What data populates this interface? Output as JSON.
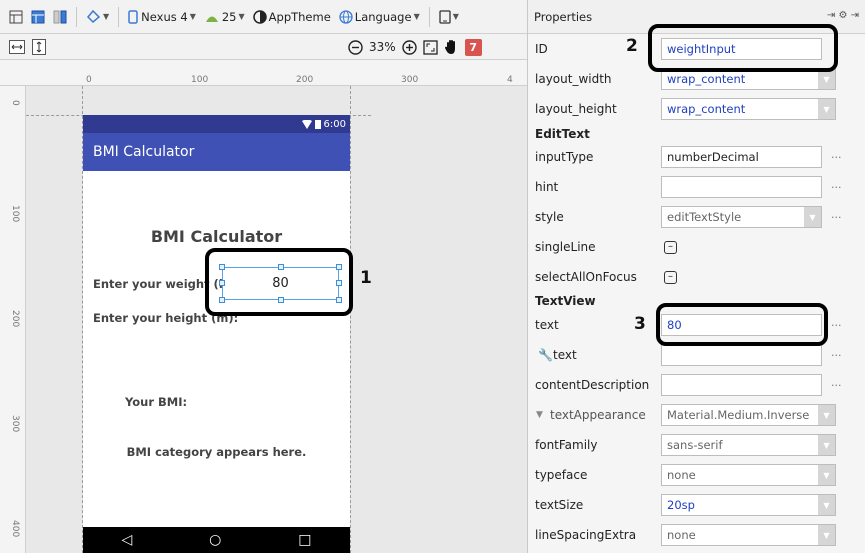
{
  "toolbar": {
    "device": "Nexus 4",
    "api": "25",
    "theme": "AppTheme",
    "language": "Language"
  },
  "toolbar2": {
    "zoom": "33%",
    "issues_count": "7"
  },
  "ruler": {
    "h_ticks": [
      "0",
      "100",
      "200",
      "300",
      "4"
    ],
    "v_ticks": [
      "0",
      "100",
      "200",
      "300",
      "400"
    ]
  },
  "phone": {
    "status_time": "6:00",
    "app_title": "BMI Calculator",
    "heading": "BMI Calculator",
    "weight_label": "Enter your weight (kg):",
    "weight_value": "80",
    "height_label": "Enter your height (m):",
    "bmi_label": "Your BMI:",
    "category_text": "BMI category appears here.",
    "nav": {
      "back": "◁",
      "home": "○",
      "recents": "□"
    }
  },
  "callouts": {
    "one": "1",
    "two": "2",
    "three": "3"
  },
  "properties": {
    "header": "Properties",
    "rows": {
      "id": {
        "name": "ID",
        "value": "weightInput"
      },
      "layout_width": {
        "name": "layout_width",
        "value": "wrap_content"
      },
      "layout_height": {
        "name": "layout_height",
        "value": "wrap_content"
      },
      "edittext_section": "EditText",
      "input_type": {
        "name": "inputType",
        "value": "numberDecimal"
      },
      "hint": {
        "name": "hint",
        "value": ""
      },
      "style": {
        "name": "style",
        "value": "editTextStyle"
      },
      "single_line": {
        "name": "singleLine"
      },
      "select_all": {
        "name": "selectAllOnFocus"
      },
      "textview_section": "TextView",
      "text": {
        "name": "text",
        "value": "80"
      },
      "tools_text": {
        "name": "text",
        "value": ""
      },
      "content_desc": {
        "name": "contentDescription",
        "value": ""
      },
      "text_appearance": {
        "name": "textAppearance",
        "value": "Material.Medium.Inverse"
      },
      "font_family": {
        "name": "fontFamily",
        "value": "sans-serif"
      },
      "typeface": {
        "name": "typeface",
        "value": "none"
      },
      "text_size": {
        "name": "textSize",
        "value": "20sp"
      },
      "line_spacing": {
        "name": "lineSpacingExtra",
        "value": "none"
      }
    }
  },
  "colors": {
    "status_bar": "#2f3a90",
    "app_bar": "#3f51b5",
    "selection": "#5aa2e6",
    "value_blue": "#1f3fbf",
    "issue_badge": "#d9534f"
  }
}
